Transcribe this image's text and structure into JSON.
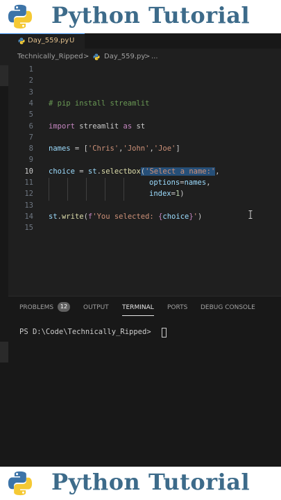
{
  "banner": {
    "title": "Python Tutorial"
  },
  "tab": {
    "filename": "Day_559.py",
    "status": "U"
  },
  "breadcrumb": {
    "folder": "Technically_Ripped",
    "sep1": ">",
    "file": "Day_559.py",
    "sep2": ">",
    "more": "..."
  },
  "editor": {
    "line_numbers": [
      "1",
      "2",
      "3",
      "4",
      "5",
      "6",
      "7",
      "8",
      "9",
      "10",
      "11",
      "12",
      "13",
      "14",
      "15"
    ],
    "active_line": "10",
    "code": {
      "l4": "# pip install streamlit",
      "l6": {
        "import": "import",
        "module": "streamlit",
        "as": "as",
        "alias": "st"
      },
      "l8": {
        "var": "names",
        "eq": " = [",
        "s1": "'Chris'",
        "c1": ",",
        "s2": "'John'",
        "c2": ",",
        "s3": "'Joe'",
        "end": "]"
      },
      "l10": {
        "var": "choice",
        "eq": " = ",
        "obj": "st",
        "dot": ".",
        "fn": "selectbox",
        "paren": "(",
        "str": "'Select a name:'",
        "comma": ","
      },
      "l11": {
        "param": "options",
        "eq": "=",
        "val": "names",
        "comma": ","
      },
      "l12": {
        "param": "index",
        "eq": "=",
        "num": "1",
        "end": ")"
      },
      "l14": {
        "obj": "st",
        "dot": ".",
        "fn": "write",
        "paren": "(",
        "prefix": "f",
        "str1": "'You selected: ",
        "brace_open": "{",
        "var": "choice",
        "brace_close": "}",
        "str2": "'",
        "end": ")"
      }
    }
  },
  "panel": {
    "tabs": {
      "problems": "PROBLEMS",
      "problems_count": "12",
      "output": "OUTPUT",
      "terminal": "TERMINAL",
      "ports": "PORTS",
      "debug": "DEBUG CONSOLE"
    },
    "terminal_prompt": "PS D:\\Code\\Technically_Ripped> "
  },
  "colors": {
    "accent": "#3b8eea",
    "selection": "#264f78",
    "modified": "#e2c08d",
    "banner_text": "#3d6b8a"
  }
}
